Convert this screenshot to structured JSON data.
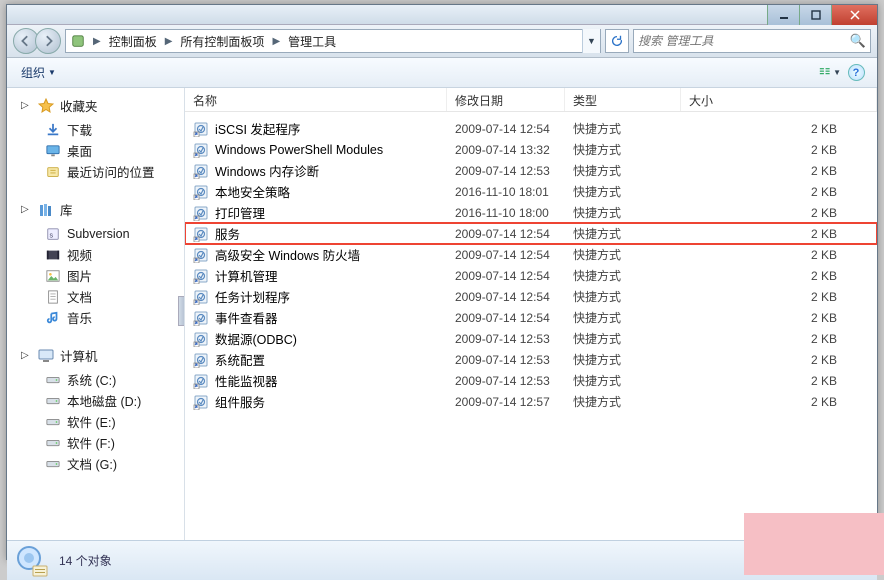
{
  "titlebar": {},
  "addressbar": {
    "crumbs": [
      "控制面板",
      "所有控制面板项",
      "管理工具"
    ],
    "search_placeholder": "搜索 管理工具"
  },
  "toolbar": {
    "organize_label": "组织"
  },
  "navpane": {
    "groups": [
      {
        "label": "收藏夹",
        "icon": "star",
        "items": [
          {
            "label": "下载",
            "icon": "download"
          },
          {
            "label": "桌面",
            "icon": "desktop"
          },
          {
            "label": "最近访问的位置",
            "icon": "recent"
          }
        ]
      },
      {
        "label": "库",
        "icon": "library",
        "items": [
          {
            "label": "Subversion",
            "icon": "svn"
          },
          {
            "label": "视频",
            "icon": "video"
          },
          {
            "label": "图片",
            "icon": "picture"
          },
          {
            "label": "文档",
            "icon": "doc"
          },
          {
            "label": "音乐",
            "icon": "music"
          }
        ]
      },
      {
        "label": "计算机",
        "icon": "computer",
        "items": [
          {
            "label": "系统 (C:)",
            "icon": "drive"
          },
          {
            "label": "本地磁盘 (D:)",
            "icon": "drive"
          },
          {
            "label": "软件 (E:)",
            "icon": "drive"
          },
          {
            "label": "软件 (F:)",
            "icon": "drive"
          },
          {
            "label": "文档 (G:)",
            "icon": "drive"
          }
        ]
      }
    ]
  },
  "list": {
    "columns": {
      "name": "名称",
      "date": "修改日期",
      "type": "类型",
      "size": "大小"
    },
    "rows": [
      {
        "name": "iSCSI 发起程序",
        "date": "2009-07-14 12:54",
        "type": "快捷方式",
        "size": "2 KB",
        "highlight": false
      },
      {
        "name": "Windows PowerShell Modules",
        "date": "2009-07-14 13:32",
        "type": "快捷方式",
        "size": "2 KB",
        "highlight": false
      },
      {
        "name": "Windows 内存诊断",
        "date": "2009-07-14 12:53",
        "type": "快捷方式",
        "size": "2 KB",
        "highlight": false
      },
      {
        "name": "本地安全策略",
        "date": "2016-11-10 18:01",
        "type": "快捷方式",
        "size": "2 KB",
        "highlight": false
      },
      {
        "name": "打印管理",
        "date": "2016-11-10 18:00",
        "type": "快捷方式",
        "size": "2 KB",
        "highlight": false
      },
      {
        "name": "服务",
        "date": "2009-07-14 12:54",
        "type": "快捷方式",
        "size": "2 KB",
        "highlight": true
      },
      {
        "name": "高级安全 Windows 防火墙",
        "date": "2009-07-14 12:54",
        "type": "快捷方式",
        "size": "2 KB",
        "highlight": false
      },
      {
        "name": "计算机管理",
        "date": "2009-07-14 12:54",
        "type": "快捷方式",
        "size": "2 KB",
        "highlight": false
      },
      {
        "name": "任务计划程序",
        "date": "2009-07-14 12:54",
        "type": "快捷方式",
        "size": "2 KB",
        "highlight": false
      },
      {
        "name": "事件查看器",
        "date": "2009-07-14 12:54",
        "type": "快捷方式",
        "size": "2 KB",
        "highlight": false
      },
      {
        "name": "数据源(ODBC)",
        "date": "2009-07-14 12:53",
        "type": "快捷方式",
        "size": "2 KB",
        "highlight": false
      },
      {
        "name": "系统配置",
        "date": "2009-07-14 12:53",
        "type": "快捷方式",
        "size": "2 KB",
        "highlight": false
      },
      {
        "name": "性能监视器",
        "date": "2009-07-14 12:53",
        "type": "快捷方式",
        "size": "2 KB",
        "highlight": false
      },
      {
        "name": "组件服务",
        "date": "2009-07-14 12:57",
        "type": "快捷方式",
        "size": "2 KB",
        "highlight": false
      }
    ]
  },
  "status": {
    "text": "14 个对象"
  }
}
